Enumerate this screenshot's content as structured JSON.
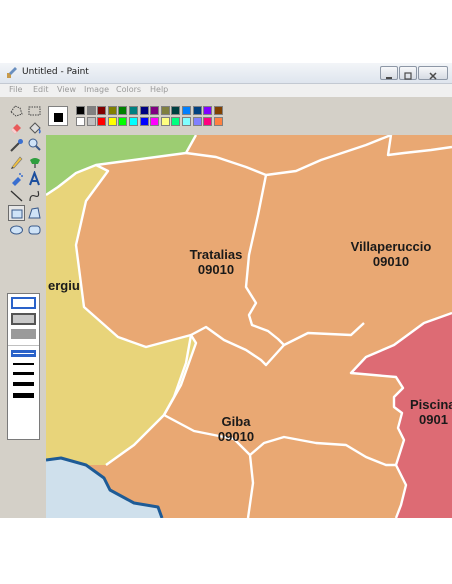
{
  "window": {
    "title": "Untitled - Paint",
    "icon": "paint-brush-icon",
    "controls": [
      "minimize-icon",
      "maximize-icon",
      "close-icon"
    ]
  },
  "menu": {
    "file": "File",
    "edit": "Edit",
    "view": "View",
    "image": "Image",
    "colors": "Colors",
    "help": "Help"
  },
  "tools": [
    "free-form-select-icon",
    "select-icon",
    "eraser-icon",
    "fill-icon",
    "pick-color-icon",
    "magnifier-icon",
    "pencil-icon",
    "brush-icon",
    "airbrush-icon",
    "text-icon",
    "line-icon",
    "curve-icon",
    "rectangle-icon",
    "polygon-icon",
    "ellipse-icon",
    "rounded-rectangle-icon"
  ],
  "palette": {
    "foreground": "#000000",
    "background": "#ffffff",
    "row1": [
      "#000000",
      "#808080",
      "#800000",
      "#808000",
      "#008000",
      "#008080",
      "#000080",
      "#800080",
      "#808040",
      "#004040",
      "#0080ff",
      "#004080",
      "#8000ff",
      "#804000"
    ],
    "row2": [
      "#ffffff",
      "#c0c0c0",
      "#ff0000",
      "#ffff00",
      "#00ff00",
      "#00ffff",
      "#0000ff",
      "#ff00ff",
      "#ffff80",
      "#00ff80",
      "#80ffff",
      "#8080ff",
      "#ff0080",
      "#ff8040"
    ]
  },
  "map": {
    "colors": {
      "orange": "#e9a873",
      "yellow": "#e8d47a",
      "green": "#9ccd72",
      "red": "#dd6b74",
      "sea": "#cfe0ec",
      "coast": "#1e5b96",
      "border": "#ffffff"
    },
    "regions": [
      {
        "name": "Tratalias",
        "code": "09010"
      },
      {
        "name": "Villaperuccio",
        "code": "09010"
      },
      {
        "name": "Giba",
        "code": "09010"
      },
      {
        "name": "Piscina",
        "code": "0901"
      },
      {
        "name": "ergiu",
        "code": ""
      }
    ]
  }
}
